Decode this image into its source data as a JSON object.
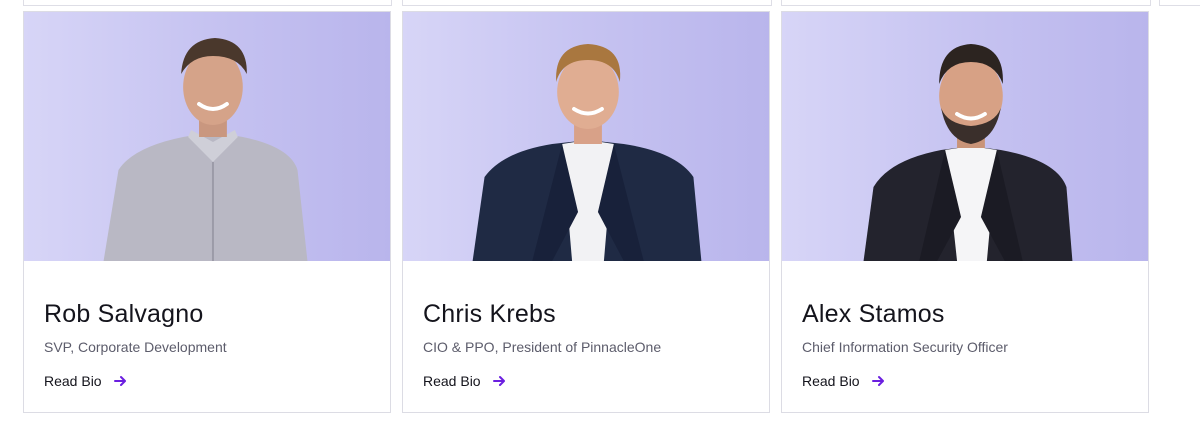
{
  "team": {
    "members": [
      {
        "name": "Rob Salvagno",
        "title": "SVP, Corporate Development",
        "link_label": "Read Bio",
        "icon": "arrow-right-icon"
      },
      {
        "name": "Chris Krebs",
        "title": "CIO & PPO, President of PinnacleOne",
        "link_label": "Read Bio",
        "icon": "arrow-right-icon"
      },
      {
        "name": "Alex Stamos",
        "title": "Chief Information Security Officer",
        "link_label": "Read Bio",
        "icon": "arrow-right-icon"
      }
    ]
  },
  "colors": {
    "accent": "#6b1fe0",
    "photo_bg_light": "#d7d5f7",
    "photo_bg_dark": "#b9b5ec",
    "name_text": "#14141c",
    "role_text": "#5c5c6b",
    "card_border": "#dcdce4"
  }
}
